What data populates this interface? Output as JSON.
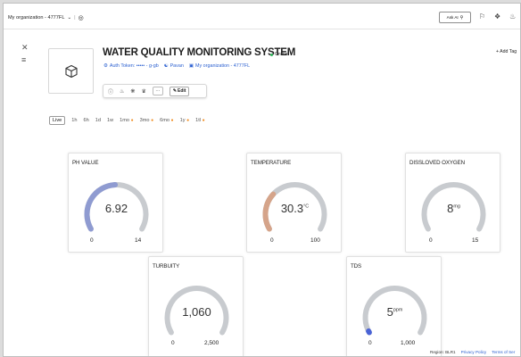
{
  "topbar": {
    "org_label": "My organization - 4777FL",
    "ask_ai_label": "Ask AI"
  },
  "device": {
    "title": "WATER QUALITY MONITORING SYSTEM",
    "status": "Online",
    "auth_token": "Auth Token: ••••• - g-gb",
    "owner": "Pavan",
    "organization": "My organization - 4777FL",
    "edit_label": "Edit",
    "add_tag_label": "+ Add Tag"
  },
  "time_range": {
    "selected": "Live",
    "options": [
      "1h",
      "6h",
      "1d",
      "1w",
      "1mo",
      "3mo",
      "6mo",
      "1y",
      "1tl"
    ],
    "pro_marked": [
      "1mo",
      "3mo",
      "6mo",
      "1y",
      "1tl"
    ]
  },
  "colors": {
    "ph_arc": "#8f9bd1",
    "temperature_arc": "#d5a48a",
    "tds_arc": "#4a63d6",
    "track": "#c8cbcf",
    "online": "#2fb65a",
    "link": "#2a5fd0",
    "pro_dot": "#f08a1c"
  },
  "gauges": [
    {
      "id": "ph",
      "title": "PH VALUE",
      "value_label": "6.92",
      "unit": "",
      "min": "0",
      "max": "14",
      "fraction": 0.49,
      "color_key": "ph_arc"
    },
    {
      "id": "temperature",
      "title": "TEMPERATURE",
      "value_label": "30.3",
      "unit": "°C",
      "min": "0",
      "max": "100",
      "fraction": 0.303,
      "color_key": "temperature_arc"
    },
    {
      "id": "oxygen",
      "title": "DISSLOVED OXYGEN",
      "value_label": "8",
      "unit": "mg",
      "min": "0",
      "max": "15",
      "fraction": 0.0,
      "color_key": "track"
    },
    {
      "id": "turbidity",
      "title": "TURBUITY",
      "value_label": "1,060",
      "unit": "",
      "min": "0",
      "max": "2,500",
      "fraction": 0.0,
      "color_key": "track"
    },
    {
      "id": "tds",
      "title": "TDS",
      "value_label": "5",
      "unit": "ppm",
      "min": "0",
      "max": "1,000",
      "fraction": 0.005,
      "color_key": "tds_arc"
    }
  ],
  "footer": {
    "region": "Region: BLR1",
    "privacy": "Privacy Policy",
    "terms": "Terms of Ser"
  }
}
